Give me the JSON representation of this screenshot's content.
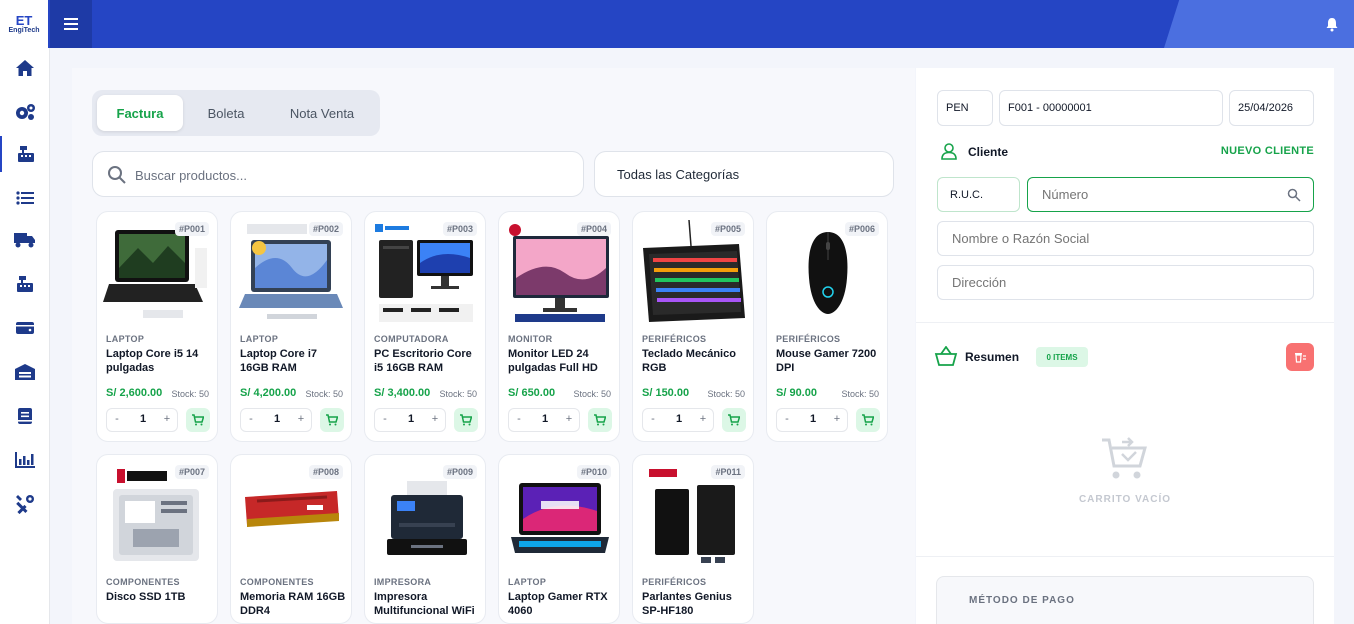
{
  "app": {
    "logo_mark": "ET",
    "logo_text": "EngiTech"
  },
  "sidebar": {
    "items": [
      {
        "icon": "home-icon"
      },
      {
        "icon": "gears-icon"
      },
      {
        "icon": "cash-register-icon",
        "active": true
      },
      {
        "icon": "list-icon"
      },
      {
        "icon": "truck-icon"
      },
      {
        "icon": "cash-register-icon"
      },
      {
        "icon": "wallet-icon"
      },
      {
        "icon": "warehouse-icon"
      },
      {
        "icon": "book-icon"
      },
      {
        "icon": "chart-bar-icon"
      },
      {
        "icon": "tools-icon"
      }
    ]
  },
  "doc_tabs": [
    "Factura",
    "Boleta",
    "Nota Venta"
  ],
  "search": {
    "placeholder": "Buscar productos..."
  },
  "category_filter": {
    "selected": "Todas las Categorías"
  },
  "products": [
    {
      "code": "#P001",
      "category": "LAPTOP",
      "name": "Laptop Core i5 14 pulgadas",
      "price": "S/ 2,600.00",
      "stock": "Stock: 50",
      "qty": "1"
    },
    {
      "code": "#P002",
      "category": "LAPTOP",
      "name": "Laptop Core i7 16GB RAM",
      "price": "S/ 4,200.00",
      "stock": "Stock: 50",
      "qty": "1"
    },
    {
      "code": "#P003",
      "category": "COMPUTADORA",
      "name": "PC Escritorio Core i5 16GB RAM",
      "price": "S/ 3,400.00",
      "stock": "Stock: 50",
      "qty": "1"
    },
    {
      "code": "#P004",
      "category": "MONITOR",
      "name": "Monitor LED 24 pulgadas Full HD",
      "price": "S/ 650.00",
      "stock": "Stock: 50",
      "qty": "1"
    },
    {
      "code": "#P005",
      "category": "PERIFÉRICOS",
      "name": "Teclado Mecánico RGB",
      "price": "S/ 150.00",
      "stock": "Stock: 50",
      "qty": "1"
    },
    {
      "code": "#P006",
      "category": "PERIFÉRICOS",
      "name": "Mouse Gamer 7200 DPI",
      "price": "S/ 90.00",
      "stock": "Stock: 50",
      "qty": "1"
    },
    {
      "code": "#P007",
      "category": "COMPONENTES",
      "name": "Disco SSD 1TB",
      "price": "",
      "stock": "",
      "qty": ""
    },
    {
      "code": "#P008",
      "category": "COMPONENTES",
      "name": "Memoria RAM 16GB DDR4",
      "price": "",
      "stock": "",
      "qty": ""
    },
    {
      "code": "#P009",
      "category": "IMPRESORA",
      "name": "Impresora Multifuncional WiFi",
      "price": "",
      "stock": "",
      "qty": ""
    },
    {
      "code": "#P010",
      "category": "LAPTOP",
      "name": "Laptop Gamer RTX 4060",
      "price": "",
      "stock": "",
      "qty": ""
    },
    {
      "code": "#P011",
      "category": "PERIFÉRICOS",
      "name": "Parlantes Genius SP-HF180",
      "price": "",
      "stock": "",
      "qty": ""
    }
  ],
  "stepper": {
    "minus": "-",
    "plus": "+"
  },
  "sale": {
    "currency": "PEN",
    "series_number": "F001 - 00000001",
    "date": "25/04/2026",
    "client_label": "Cliente",
    "new_client": "NUEVO CLIENTE",
    "doc_type": "R.U.C.",
    "number_placeholder": "Número",
    "name_placeholder": "Nombre o Razón Social",
    "address_placeholder": "Dirección",
    "summary_label": "Resumen",
    "items_badge": "0 ITEMS",
    "empty_cart": "CARRITO VACÍO",
    "payment_method": "MÉTODO DE PAGO"
  },
  "colors": {
    "primary": "#2545c4",
    "accent": "#16a34a",
    "danger": "#f87171"
  }
}
